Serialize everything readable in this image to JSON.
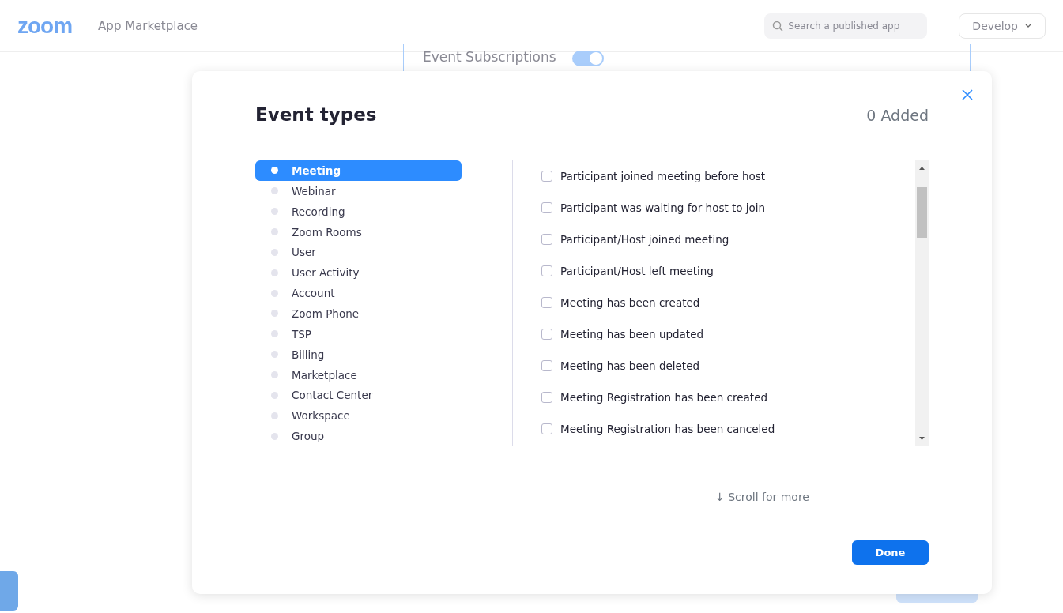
{
  "header": {
    "logo": "zoom",
    "title": "App Marketplace",
    "search": {
      "placeholder": "Search a published app"
    },
    "menu": "Develop"
  },
  "background_panel": {
    "title": "Event Subscriptions",
    "toggle": {
      "on": true
    }
  },
  "dialog": {
    "title": "Event types",
    "count": "0 Added",
    "categories": [
      {
        "label": "Meeting",
        "selected": true
      },
      {
        "label": "Webinar",
        "selected": false
      },
      {
        "label": "Recording",
        "selected": false
      },
      {
        "label": "Zoom Rooms",
        "selected": false
      },
      {
        "label": "User",
        "selected": false
      },
      {
        "label": "User Activity",
        "selected": false
      },
      {
        "label": "Account",
        "selected": false
      },
      {
        "label": "Zoom Phone",
        "selected": false
      },
      {
        "label": "TSP",
        "selected": false
      },
      {
        "label": "Billing",
        "selected": false
      },
      {
        "label": "Marketplace",
        "selected": false
      },
      {
        "label": "Contact Center",
        "selected": false
      },
      {
        "label": "Workspace",
        "selected": false
      },
      {
        "label": "Group",
        "selected": false
      }
    ],
    "events": [
      {
        "label": "Participant joined meeting before host",
        "checked": false
      },
      {
        "label": "Participant was waiting for host to join",
        "checked": false
      },
      {
        "label": "Participant/Host joined meeting",
        "checked": false
      },
      {
        "label": "Participant/Host left meeting",
        "checked": false
      },
      {
        "label": "Meeting has been created",
        "checked": false
      },
      {
        "label": "Meeting has been updated",
        "checked": false
      },
      {
        "label": "Meeting has been deleted",
        "checked": false
      },
      {
        "label": "Meeting Registration has been created",
        "checked": false
      },
      {
        "label": "Meeting Registration has been canceled",
        "checked": false
      }
    ],
    "scroll_hint": "↓ Scroll for more",
    "done": "Done"
  }
}
